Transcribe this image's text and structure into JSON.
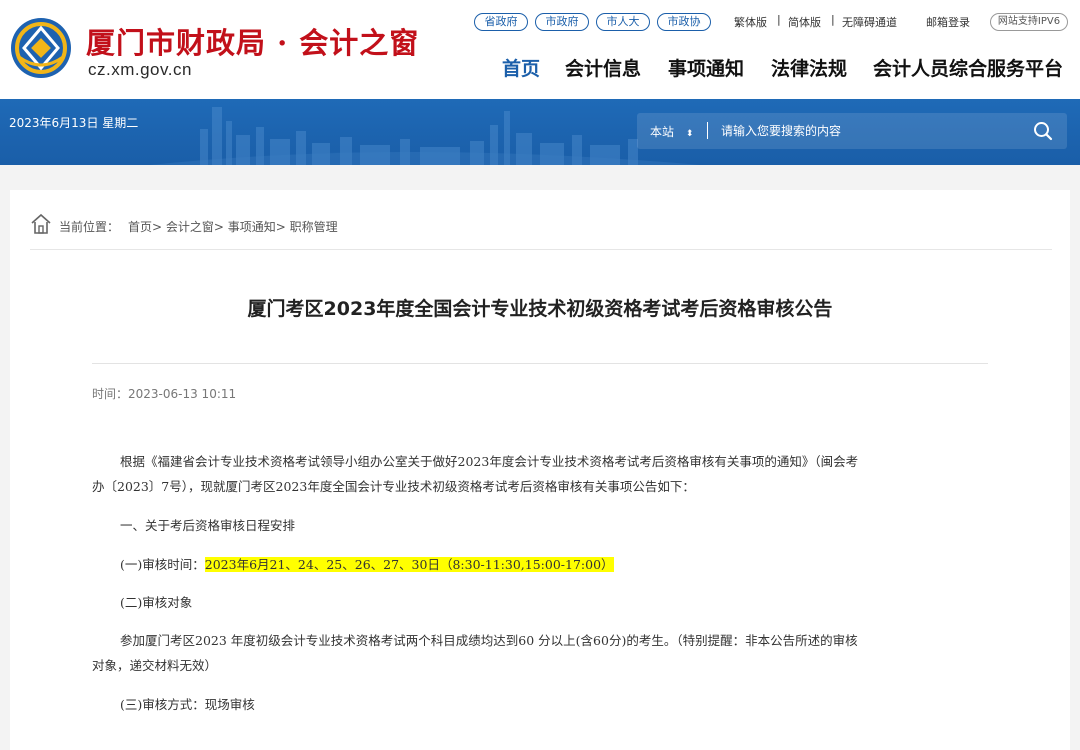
{
  "header": {
    "site_name": "厦门市财政局 · 会计之窗",
    "domain": "cz.xm.gov.cn",
    "gov_links": [
      "省政府",
      "市政府",
      "市人大",
      "市政协"
    ],
    "utility_links": [
      "繁体版",
      "简体版",
      "无障碍通道",
      "邮箱登录"
    ],
    "ipv6_badge": "网站支持IPV6",
    "nav": [
      "首页",
      "会计信息",
      "事项通知",
      "法律法规",
      "会计人员综合服务平台"
    ],
    "active_nav": "首页",
    "colors": {
      "brand_red": "#c2101a",
      "brand_blue": "#1b5faa"
    }
  },
  "banner": {
    "date": "2023年6月13日 星期二",
    "search_scope": "本站",
    "search_placeholder": "请输入您要搜索的内容"
  },
  "breadcrumb": {
    "label": "当前位置：",
    "items": [
      "首页",
      "会计之窗",
      "事项通知",
      "职称管理"
    ]
  },
  "article": {
    "title": "厦门考区2023年度全国会计专业技术初级资格考试考后资格审核公告",
    "time": "时间：2023-06-13 10:11",
    "para1_line1": "根据《福建省会计专业技术资格考试领导小组办公室关于做好2023年度会计专业技术资格考试考后资格审核有关事项的通知》（闽会考",
    "para1_line2": "办〔2023〕7号），现就厦门考区2023年度全国会计专业技术初级资格考试考后资格审核有关事项公告如下：",
    "section1": "一、关于考后资格审核日程安排",
    "item1_label": "(一)审核时间：",
    "item1_value": "2023年6月21、24、25、26、27、30日（8:30-11:30,15:00-17:00）",
    "item2": "(二)审核对象",
    "item2_line1": "参加厦门考区2023 年度初级会计专业技术资格考试两个科目成绩均达到60 分以上(含60分)的考生。（特别提醒：非本公告所述的审核",
    "item2_line2": "对象，递交材料无效）",
    "item3": "(三)审核方式：现场审核"
  }
}
